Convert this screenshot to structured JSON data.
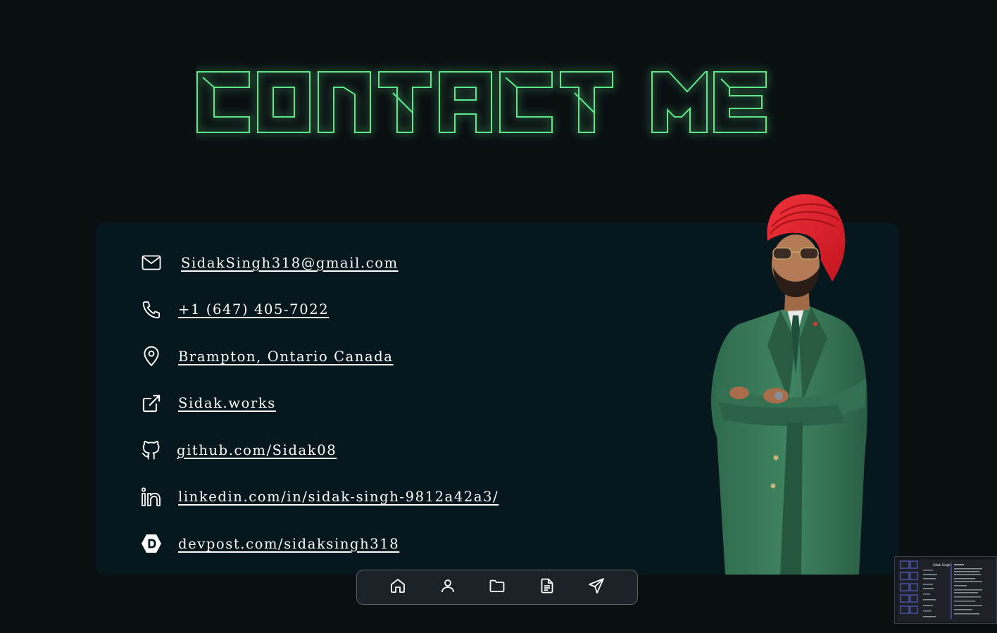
{
  "page": {
    "title": "CONTACT ME",
    "accent_color": "#5fe88a"
  },
  "contacts": [
    {
      "icon": "mail-icon",
      "label": "SidakSingh318@gmail.com"
    },
    {
      "icon": "phone-icon",
      "label": "+1 (647) 405-7022"
    },
    {
      "icon": "map-pin-icon",
      "label": "Brampton, Ontario Canada"
    },
    {
      "icon": "external-link-icon",
      "label": "Sidak.works"
    },
    {
      "icon": "github-icon",
      "label": "github.com/Sidak08"
    },
    {
      "icon": "linkedin-icon",
      "label": "linkedin.com/in/sidak-singh-9812a42a3/"
    },
    {
      "icon": "devpost-icon",
      "label": "devpost.com/sidaksingh318"
    }
  ],
  "dock": {
    "items": [
      {
        "icon": "home-icon",
        "name": "Home"
      },
      {
        "icon": "user-icon",
        "name": "About"
      },
      {
        "icon": "folder-icon",
        "name": "Projects"
      },
      {
        "icon": "document-icon",
        "name": "Resume"
      },
      {
        "icon": "send-icon",
        "name": "Contact"
      }
    ]
  },
  "thumbnail": {
    "heading": "Sidak Singh"
  }
}
